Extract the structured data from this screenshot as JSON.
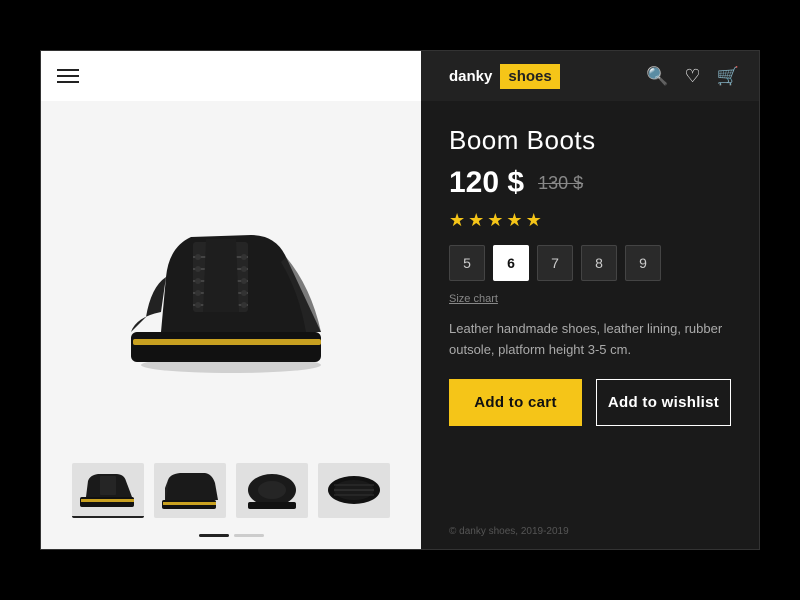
{
  "brand": {
    "danky": "danky",
    "shoes": "shoes"
  },
  "product": {
    "name": "Boom Boots",
    "price_current": "120 $",
    "price_old": "130 $",
    "rating": 5,
    "description": "Leather handmade shoes, leather lining, rubber outsole, platform height 3-5 cm.",
    "sizes": [
      "5",
      "6",
      "7",
      "8",
      "9"
    ],
    "selected_size": "6"
  },
  "buttons": {
    "add_to_cart": "Add to cart",
    "add_to_wishlist": "Add to wishlist"
  },
  "links": {
    "size_chart": "Size chart"
  },
  "footer": {
    "copy": "© danky shoes, 2019-2019"
  }
}
